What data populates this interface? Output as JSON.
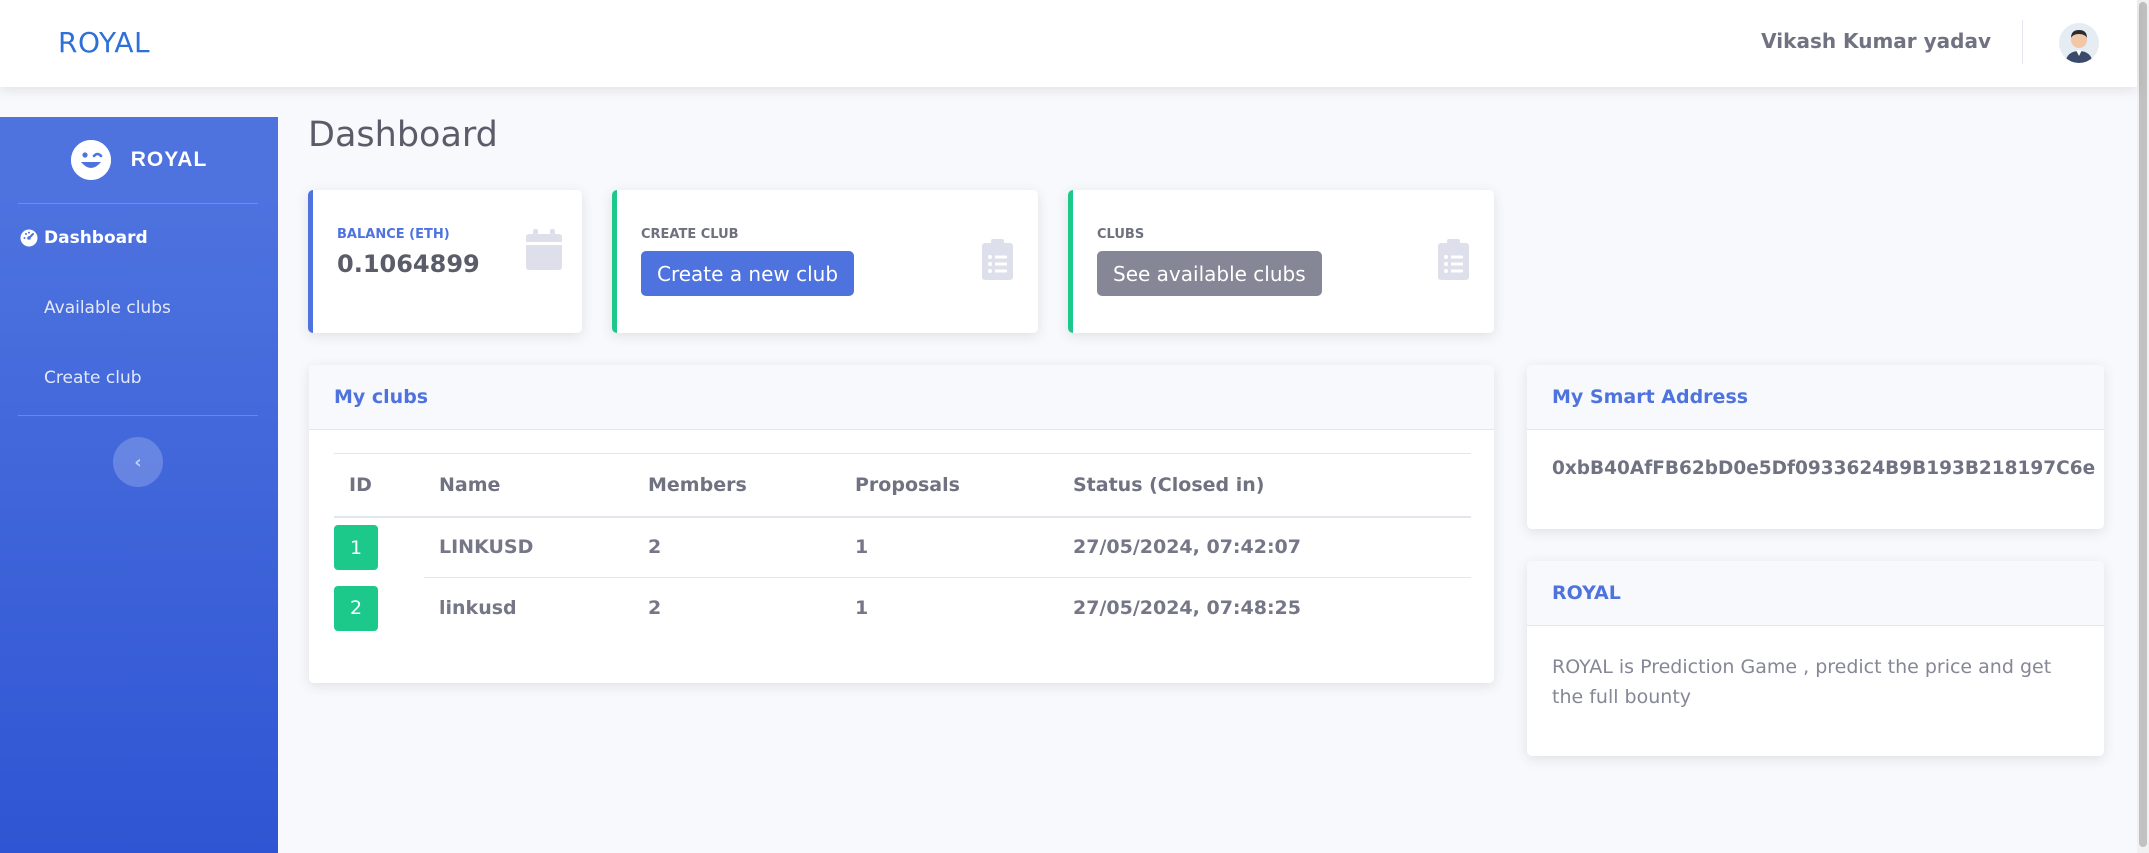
{
  "topbar": {
    "brand": "ROYAL",
    "user_name": "Vikash Kumar yadav"
  },
  "sidebar": {
    "brand": "ROYAL",
    "items": [
      {
        "label": "Dashboard",
        "active": true,
        "icon": "tachometer-icon"
      },
      {
        "label": "Available clubs",
        "active": false
      },
      {
        "label": "Create club",
        "active": false
      }
    ],
    "toggle_icon": "chevron-left-icon"
  },
  "main": {
    "page_title": "Dashboard",
    "cards": {
      "balance": {
        "label": "BALANCE (ETH)",
        "value": "0.1064899",
        "icon": "calendar-icon"
      },
      "create": {
        "label": "CREATE CLUB",
        "button": "Create a new club",
        "icon": "clipboard-list-icon"
      },
      "clubs": {
        "label": "CLUBS",
        "button": "See available clubs",
        "icon": "clipboard-list-icon"
      }
    },
    "my_clubs": {
      "title": "My clubs",
      "columns": [
        "ID",
        "Name",
        "Members",
        "Proposals",
        "Status (Closed in)"
      ],
      "rows": [
        {
          "id": "1",
          "name": "LINKUSD",
          "members": "2",
          "proposals": "1",
          "status": "27/05/2024, 07:42:07"
        },
        {
          "id": "2",
          "name": "linkusd",
          "members": "2",
          "proposals": "1",
          "status": "27/05/2024, 07:48:25"
        }
      ]
    },
    "smart_address": {
      "title": "My Smart Address",
      "value": "0xbB40AfFB62bD0e5Df0933624B9B193B218197C6e"
    },
    "about": {
      "title": "ROYAL",
      "text": "ROYAL is Prediction Game , predict the price and get the full bounty"
    }
  },
  "colors": {
    "primary": "#4e73df",
    "success": "#1cc88a",
    "secondary": "#858796"
  }
}
